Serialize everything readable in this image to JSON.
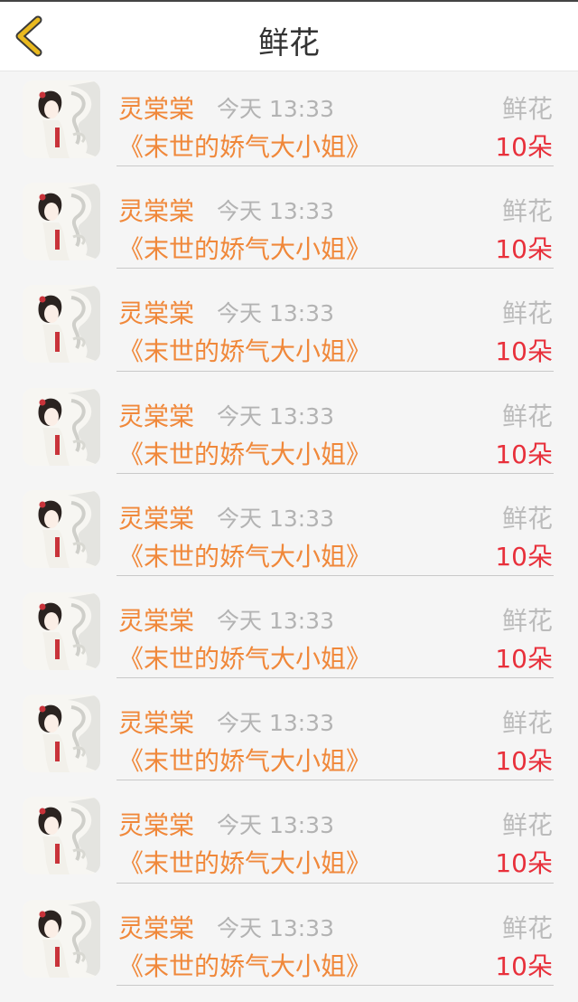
{
  "header": {
    "title": "鲜花",
    "back_icon": "chevron-left-icon"
  },
  "colors": {
    "accent": "#f0883a",
    "count_red": "#e8303b",
    "muted": "#b3b3b3",
    "back_icon": "#e9b91f"
  },
  "items": [
    {
      "name": "灵棠棠",
      "time": "今天 13:33",
      "type": "鲜花",
      "book": "《末世的娇气大小姐》",
      "count": "10朵"
    },
    {
      "name": "灵棠棠",
      "time": "今天 13:33",
      "type": "鲜花",
      "book": "《末世的娇气大小姐》",
      "count": "10朵"
    },
    {
      "name": "灵棠棠",
      "time": "今天 13:33",
      "type": "鲜花",
      "book": "《末世的娇气大小姐》",
      "count": "10朵"
    },
    {
      "name": "灵棠棠",
      "time": "今天 13:33",
      "type": "鲜花",
      "book": "《末世的娇气大小姐》",
      "count": "10朵"
    },
    {
      "name": "灵棠棠",
      "time": "今天 13:33",
      "type": "鲜花",
      "book": "《末世的娇气大小姐》",
      "count": "10朵"
    },
    {
      "name": "灵棠棠",
      "time": "今天 13:33",
      "type": "鲜花",
      "book": "《末世的娇气大小姐》",
      "count": "10朵"
    },
    {
      "name": "灵棠棠",
      "time": "今天 13:33",
      "type": "鲜花",
      "book": "《末世的娇气大小姐》",
      "count": "10朵"
    },
    {
      "name": "灵棠棠",
      "time": "今天 13:33",
      "type": "鲜花",
      "book": "《末世的娇气大小姐》",
      "count": "10朵"
    },
    {
      "name": "灵棠棠",
      "time": "今天 13:33",
      "type": "鲜花",
      "book": "《末世的娇气大小姐》",
      "count": "10朵"
    }
  ]
}
